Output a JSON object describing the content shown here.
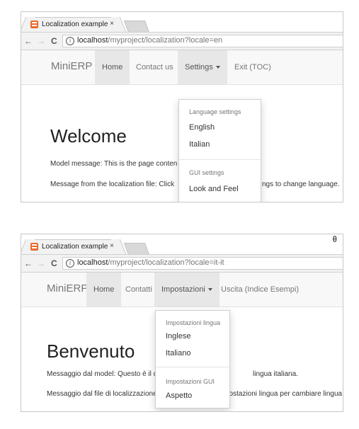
{
  "top": {
    "tab_title": "Localization example",
    "tab_close": "×",
    "url_host": "localhost",
    "url_path": "/myproject/localization?locale=en",
    "brand": "MiniERP",
    "nav": [
      "Home",
      "Contact us",
      "Settings",
      "Exit (TOC)"
    ],
    "heading": "Welcome",
    "line1": "Model message: This is the page conten",
    "line2_left": "Message from the localization file: Click",
    "line2_right": "ngs to change language.",
    "dropdown": {
      "header1": "Language settings",
      "item1": "English",
      "item2": "Italian",
      "header2": "GUI settings",
      "item3": "Look and Feel"
    }
  },
  "bottom": {
    "tab_title": "Localization example",
    "tab_close": "×",
    "url_host": "localhost",
    "url_path": "/myproject/localization?locale=it-it",
    "brand": "MiniERP",
    "nav": [
      "Home",
      "Contatti",
      "Impostazioni",
      "Uscita (Indice Esempi)"
    ],
    "heading": "Benvenuto",
    "line1_left": "Messaggio dal model: Questo è il cor",
    "line1_right": "lingua italiana.",
    "line2_left": "Messaggio dal file di localizzazione: C",
    "line2_right": "postazioni lingua per cambiare lingua.",
    "dropdown": {
      "header1": "Impostazioni lingua",
      "item1": "Inglese",
      "item2": "Italiano",
      "header2": "Impostazioni GUI",
      "item3": "Aspetto"
    }
  },
  "icons": {
    "back": "←",
    "forward": "→",
    "reload": "C",
    "info": "i",
    "profile": "θ"
  },
  "colors": {
    "tab_icon": "#e96a2c",
    "navbar_bg": "#f8f8f8",
    "active_nav_bg": "#e7e7e7"
  }
}
